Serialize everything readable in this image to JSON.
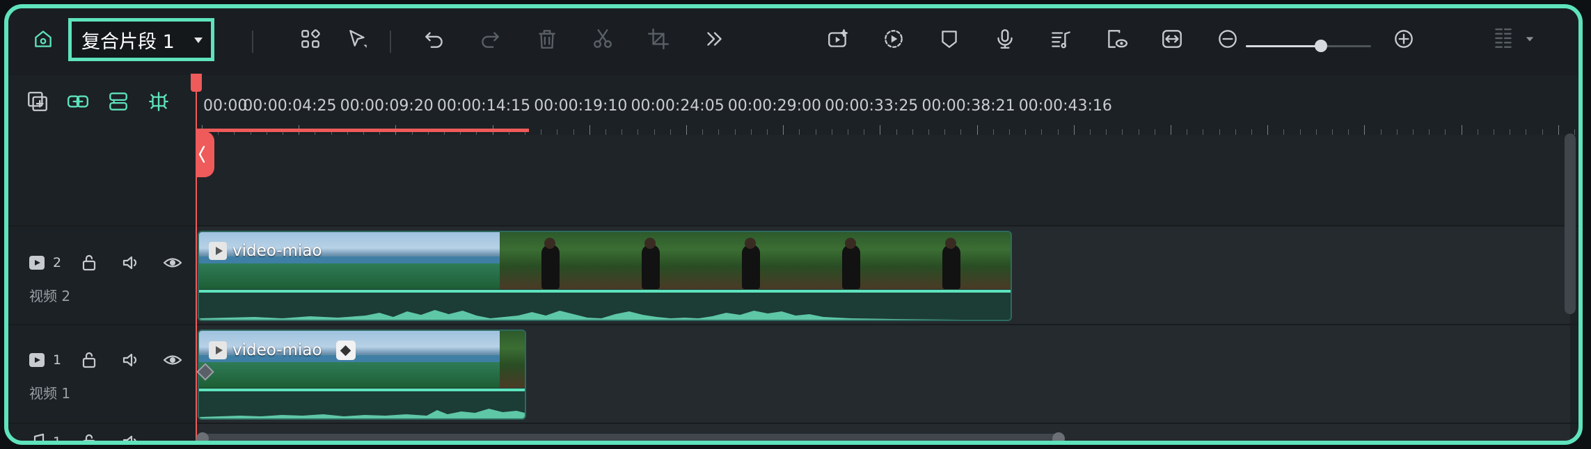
{
  "toolbar": {
    "compound_clip_label": "复合片段 1"
  },
  "ruler": {
    "ticks": [
      "00:00",
      "00:00:04:25",
      "00:00:09:20",
      "00:00:14:15",
      "00:00:19:10",
      "00:00:24:05",
      "00:00:29:00",
      "00:00:33:25",
      "00:00:38:21",
      "00:00:43:16"
    ]
  },
  "tracks": {
    "video2": {
      "number": "2",
      "name": "视频 2"
    },
    "video1": {
      "number": "1",
      "name": "视频 1"
    },
    "audio1": {
      "number": "1"
    }
  },
  "clips": {
    "video2_clip": {
      "label": "video-miao"
    },
    "video1_clip": {
      "label": "video-miao"
    }
  },
  "zoom": {
    "level": 0.6
  },
  "colors": {
    "accent": "#5ee3bd",
    "playhead": "#ef5a5a"
  }
}
